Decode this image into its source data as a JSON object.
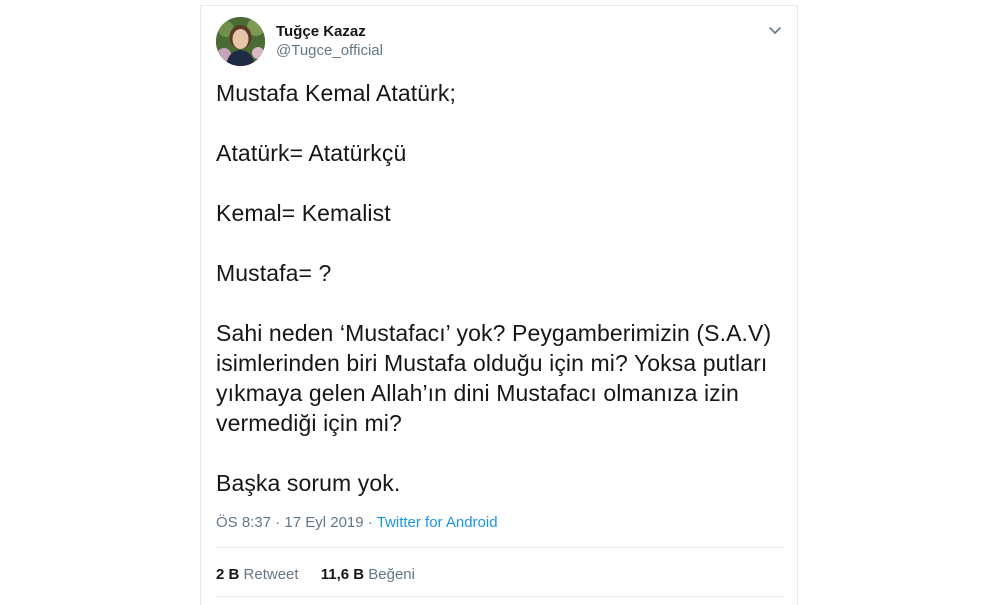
{
  "author": {
    "display_name": "Tuğçe Kazaz",
    "handle": "@Tugce_official"
  },
  "menu_icon": "chevron-down-icon",
  "tweet": {
    "paragraphs": [
      "Mustafa Kemal Atatürk;",
      "Atatürk= Atatürkçü",
      "Kemal= Kemalist",
      "Mustafa= ?",
      "Sahi neden ‘Mustafacı’ yok? Peygamberimizin (S.A.V) isimlerinden biri Mustafa olduğu için mi? Yoksa putları yıkmaya gelen Allah’ın dini Mustafacı olmanıza izin vermediği için mi?",
      "Başka sorum yok."
    ]
  },
  "meta": {
    "time": "ÖS 8:37",
    "sep1": " · ",
    "date": "17 Eyl 2019",
    "sep2": " · ",
    "source": "Twitter for Android"
  },
  "stats": {
    "retweet_count": "2 B",
    "retweet_label": "Retweet",
    "like_count": "11,6 B",
    "like_label": "Beğeni"
  },
  "colors": {
    "text": "#14171a",
    "secondary": "#657786",
    "link": "#1b95e0",
    "border": "#e6ecf0"
  }
}
